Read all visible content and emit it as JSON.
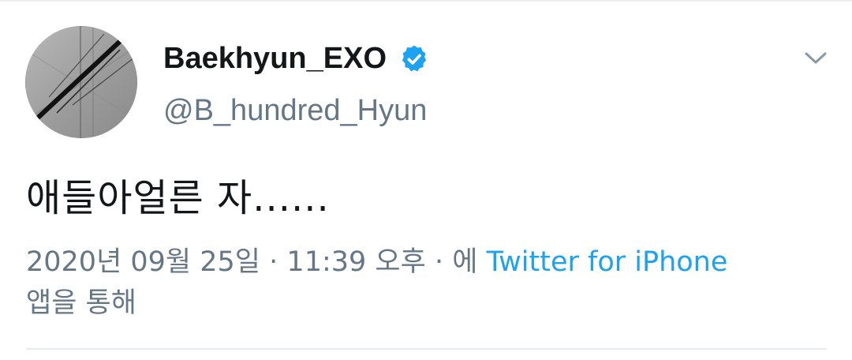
{
  "tweet": {
    "author": {
      "display_name": "Baekhyun_EXO",
      "handle": "@B_hundred_Hyun",
      "verified": true
    },
    "text": "애들아얼른 자......",
    "date": "2020년 09월 25일",
    "separator": "·",
    "time": "11:39 오후",
    "source_prefix": "에",
    "source": "Twitter for iPhone",
    "source_suffix": "앱을 통해"
  },
  "icons": {
    "verified": "verified-badge-icon",
    "menu": "chevron-down-icon"
  },
  "colors": {
    "accent": "#1da1f2",
    "secondary_text": "#657786",
    "primary_text": "#14171a",
    "divider": "#e6ecf0"
  }
}
